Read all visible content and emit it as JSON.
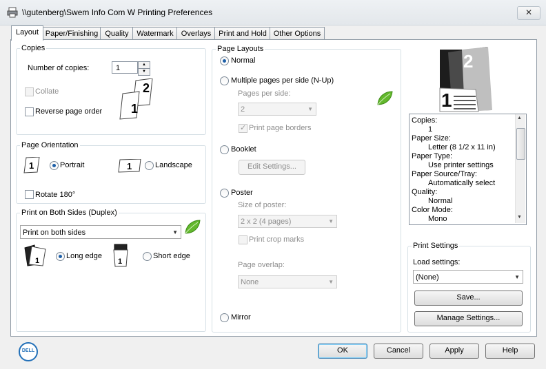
{
  "window": {
    "title": "\\\\gutenberg\\Swem Info Com W Printing Preferences",
    "close_glyph": "✕"
  },
  "tabs": [
    "Layout",
    "Paper/Finishing",
    "Quality",
    "Watermark",
    "Overlays",
    "Print and Hold",
    "Other Options"
  ],
  "copies": {
    "group_title": "Copies",
    "number_label": "Number of copies:",
    "number_value": "1",
    "collate_label": "Collate",
    "reverse_label": "Reverse page order"
  },
  "orientation": {
    "group_title": "Page Orientation",
    "portrait_label": "Portrait",
    "landscape_label": "Landscape",
    "rotate_label": "Rotate 180°"
  },
  "duplex": {
    "group_title": "Print on Both Sides (Duplex)",
    "select_value": "Print on both sides",
    "long_edge_label": "Long edge",
    "short_edge_label": "Short edge"
  },
  "layouts": {
    "group_title": "Page Layouts",
    "normal_label": "Normal",
    "nup_label": "Multiple pages per side (N-Up)",
    "pages_per_side_label": "Pages per side:",
    "pages_per_side_value": "2",
    "print_borders_label": "Print page borders",
    "booklet_label": "Booklet",
    "edit_settings_label": "Edit Settings...",
    "poster_label": "Poster",
    "size_of_poster_label": "Size of poster:",
    "size_of_poster_value": "2 x 2 (4 pages)",
    "print_crop_label": "Print crop marks",
    "page_overlap_label": "Page overlap:",
    "page_overlap_value": "None",
    "mirror_label": "Mirror"
  },
  "summary": [
    "Copies:",
    "    1",
    "Paper Size:",
    "    Letter (8 1/2 x 11 in)",
    "Paper Type:",
    "    Use printer settings",
    "Paper Source/Tray:",
    "    Automatically select",
    "Quality:",
    "    Normal",
    "Color Mode:",
    "    Mono"
  ],
  "preview_numbers": {
    "front": "1",
    "back": "2"
  },
  "print_settings": {
    "group_title": "Print Settings",
    "load_label": "Load settings:",
    "load_value": "(None)",
    "save_label": "Save...",
    "manage_label": "Manage Settings..."
  },
  "page_numbers": {
    "one": "1",
    "two": "2"
  },
  "footer": {
    "logo_text": "DELL",
    "ok": "OK",
    "cancel": "Cancel",
    "apply": "Apply",
    "help": "Help"
  },
  "colors": {
    "accent": "#1d5fa8",
    "leaf": "#5fb52a",
    "dell_blue": "#2270b8"
  }
}
